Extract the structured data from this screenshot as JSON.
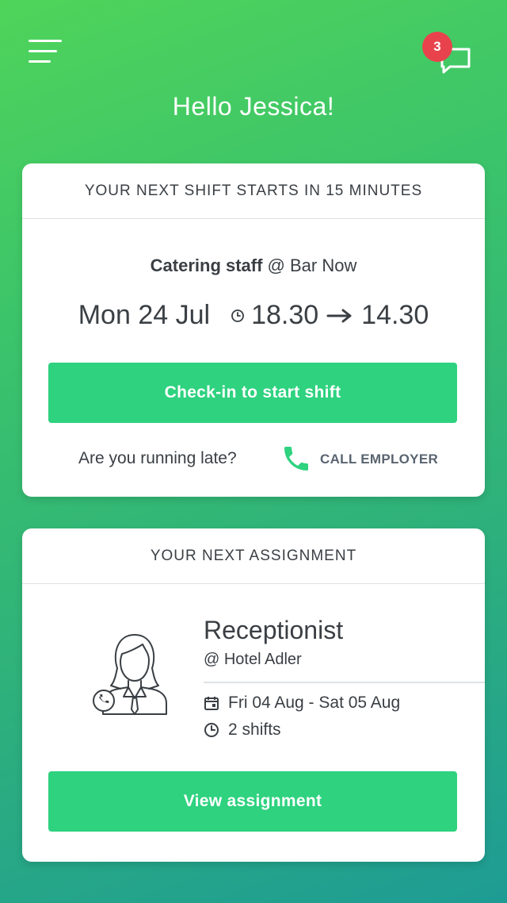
{
  "header": {
    "menu_icon": "hamburger-menu-icon",
    "chat_icon": "chat-bubble-icon",
    "notification_count": "3",
    "greeting": "Hello Jessica!"
  },
  "next_shift": {
    "heading": "YOUR NEXT SHIFT STARTS IN 15 MINUTES",
    "role": "Catering staff",
    "at_place": " @ Bar Now",
    "date": "Mon 24 Jul",
    "start_time": "18.30",
    "end_time": "14.30",
    "checkin_label": "Check-in to start shift",
    "late_prompt": "Are you running late?",
    "call_label": "CALL EMPLOYER"
  },
  "next_assignment": {
    "heading": "YOUR NEXT ASSIGNMENT",
    "title": "Receptionist",
    "place": "@ Hotel Adler",
    "dates": "Fri 04 Aug - Sat  05 Aug",
    "shifts": "2 shifts",
    "view_label": "View assignment"
  },
  "colors": {
    "accent_green": "#2ed27f",
    "badge_red": "#e8434c",
    "text_dark": "#3a3f44"
  }
}
